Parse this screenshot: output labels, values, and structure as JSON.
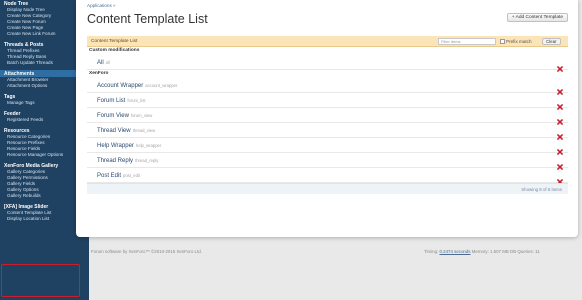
{
  "sidebar": {
    "groups": [
      {
        "head": "Node Tree",
        "active": false,
        "items": [
          "Display Node Tree",
          "Create New Category",
          "Create New Forum",
          "Create New Page",
          "Create New Link Forum"
        ]
      },
      {
        "head": "Threads & Posts",
        "active": false,
        "items": [
          "Thread Prefixes",
          "Thread Reply Bans",
          "Batch Update Threads"
        ]
      },
      {
        "head": "Attachments",
        "active": true,
        "items": [
          "Attachment Browser",
          "Attachment Options"
        ]
      },
      {
        "head": "Tags",
        "active": false,
        "items": [
          "Manage Tags"
        ]
      },
      {
        "head": "Feeder",
        "active": false,
        "items": [
          "Registered Feeds"
        ]
      },
      {
        "head": "Resources",
        "active": false,
        "items": [
          "Resource Categories",
          "Resource Prefixes",
          "Resource Fields",
          "Resource Manager Options"
        ]
      },
      {
        "head": "XenForo Media Gallery",
        "active": false,
        "items": [
          "Gallery Categories",
          "Gallery Permissions",
          "Gallery Fields",
          "Gallery Options",
          "Gallery Rebuilds"
        ]
      },
      {
        "head": "[XFA] Image Slider",
        "active": false,
        "items": [
          "Content Template List",
          "Display Location List"
        ]
      }
    ]
  },
  "breadcrumb": "Applications »",
  "page_title": "Content Template List",
  "add_button": "+ Add Content Template",
  "table": {
    "title": "Content Template List",
    "filter_placeholder": "Filter items",
    "prefix_match": "Prefix match",
    "clear": "Clear",
    "groups": [
      {
        "label": "Custom modifications",
        "rows": [
          {
            "name": "All",
            "sub": "all"
          }
        ]
      },
      {
        "label": "XenForo",
        "rows": [
          {
            "name": "Account Wrapper",
            "sub": "account_wrapper"
          },
          {
            "name": "Forum List",
            "sub": "forum_list"
          },
          {
            "name": "Forum View",
            "sub": "forum_view"
          },
          {
            "name": "Thread View",
            "sub": "thread_view"
          },
          {
            "name": "Help Wrapper",
            "sub": "help_wrapper"
          },
          {
            "name": "Thread Reply",
            "sub": "thread_reply"
          },
          {
            "name": "Post Edit",
            "sub": "post_edit"
          }
        ]
      }
    ],
    "footer": "Showing 8 of 8 items"
  },
  "footer": {
    "left": "Forum software by XenForo™ ©2010-2015 XenForo Ltd.",
    "timing_label": "Timing:",
    "timing_value": "0.2474 seconds",
    "rest": "Memory: 1.507 MB DB Queries: 11"
  },
  "colors": {
    "sidebar": "#1f4263",
    "delete": "#c8202a",
    "highlight": "#c8202a"
  }
}
